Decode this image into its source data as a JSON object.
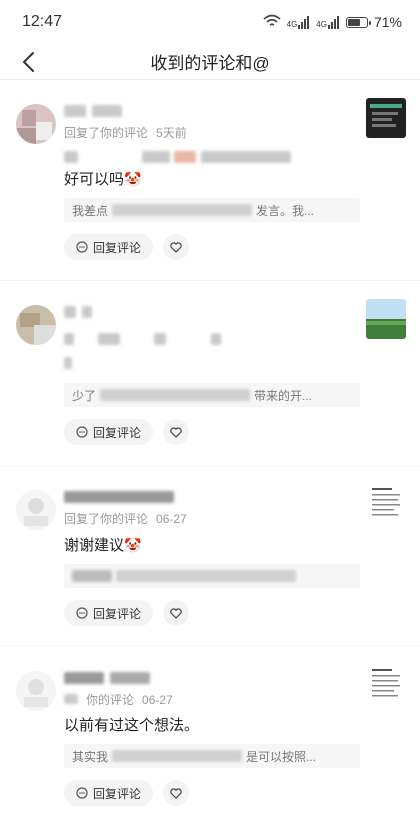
{
  "status": {
    "time": "12:47",
    "battery": "71%",
    "battery_level": 0.71,
    "net1": "4G",
    "net2": "4G"
  },
  "header": {
    "title": "收到的评论和@"
  },
  "comments": [
    {
      "meta_action": "回复了你的评论",
      "time": "5天前",
      "content_tail": "好可以吗",
      "emoji": "🤡",
      "quote_lead": "我差点",
      "quote_tail": "发言。我...",
      "reply_label": "回复评论"
    },
    {
      "meta_action": "",
      "time": "",
      "content_tail": "",
      "emoji": "",
      "quote_lead": "少了",
      "quote_tail": "带来的开...",
      "reply_label": "回复评论"
    },
    {
      "meta_action": "回复了你的评论",
      "time": "06-27",
      "content": "谢谢建议",
      "emoji": "🤡",
      "quote_lead": "",
      "quote_tail": "",
      "reply_label": "回复评论"
    },
    {
      "meta_action": "你的评论",
      "time": "06-27",
      "content": "以前有过这个想法。",
      "quote_lead": "其实我",
      "quote_tail": "是可以按照...",
      "reply_label": "回复评论"
    }
  ]
}
